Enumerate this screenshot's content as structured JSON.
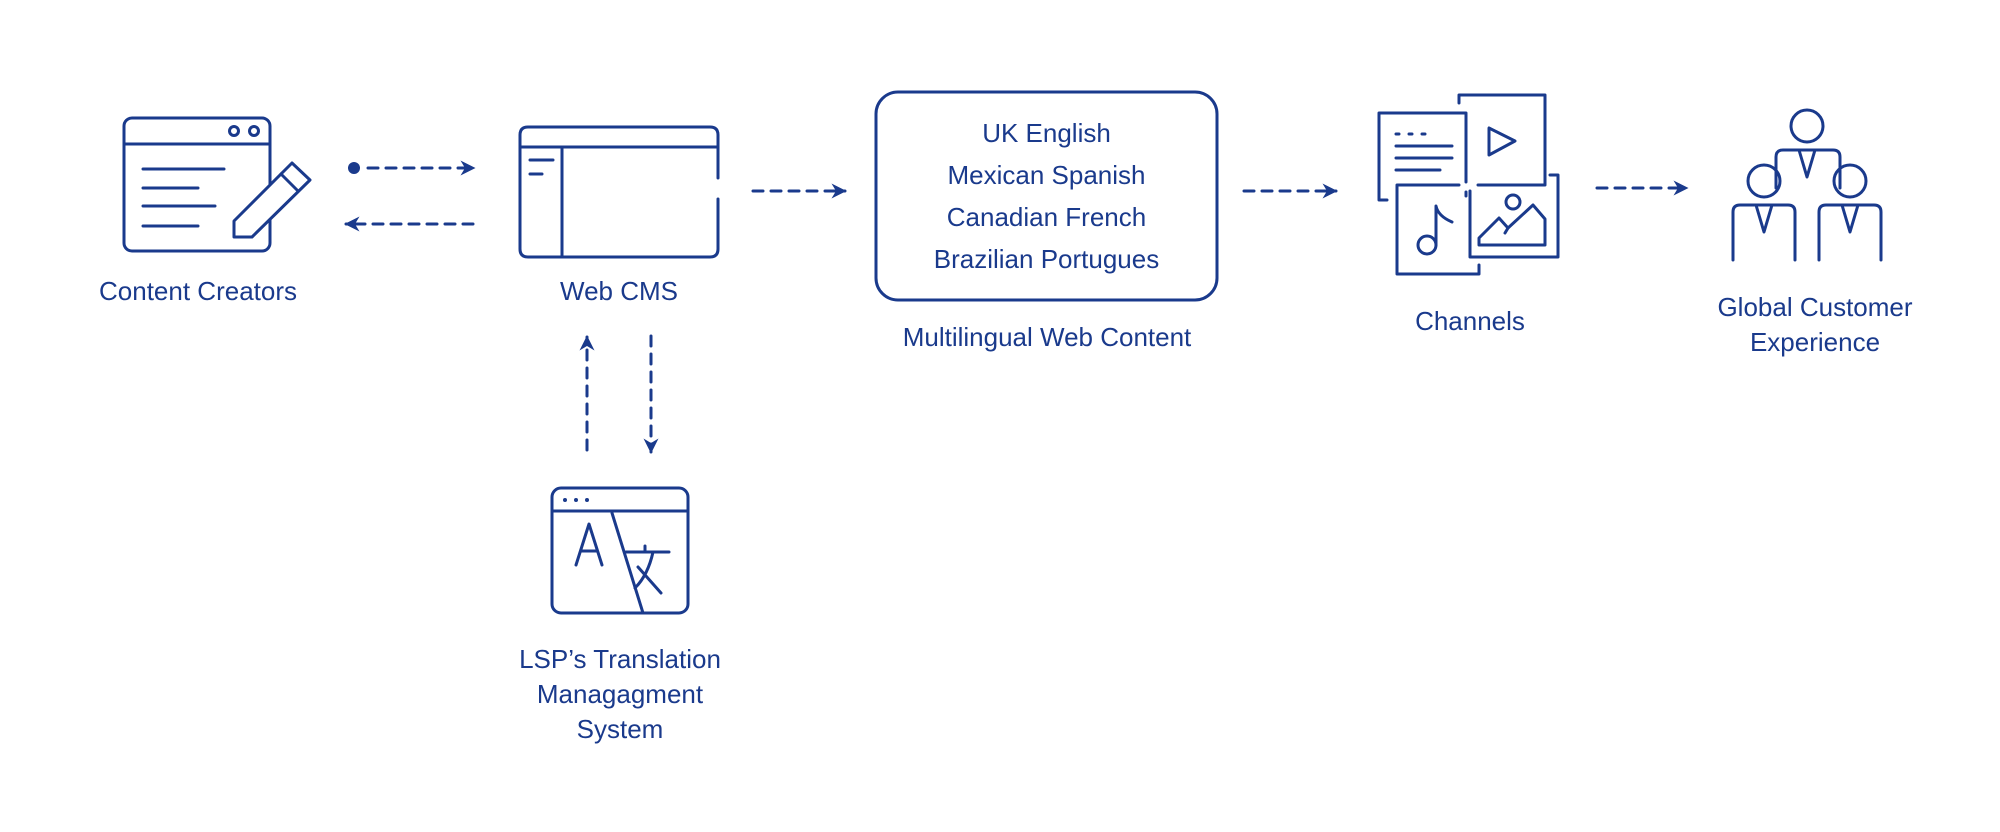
{
  "diagram": {
    "accent_color": "#1a3a8c",
    "nodes": {
      "content_creators": {
        "label": "Content Creators",
        "icon": "document-edit-icon"
      },
      "web_cms": {
        "label": "Web CMS",
        "icon": "cms-window-icon"
      },
      "multilingual": {
        "label": "Multilingual Web Content",
        "languages": [
          "UK English",
          "Mexican Spanish",
          "Canadian French",
          "Brazilian Portugues"
        ]
      },
      "channels": {
        "label": "Channels",
        "icon": "media-channels-icon"
      },
      "global_cx": {
        "label_lines": [
          "Global Customer",
          "Experience"
        ],
        "icon": "people-group-icon"
      },
      "lsp": {
        "label_lines": [
          "LSP’s Translation",
          "Managagment",
          "System"
        ],
        "icon": "translate-window-icon"
      }
    },
    "edges": [
      {
        "from": "content_creators",
        "to": "web_cms",
        "style": "dashed",
        "start": "dot"
      },
      {
        "from": "web_cms",
        "to": "content_creators",
        "style": "dashed"
      },
      {
        "from": "web_cms",
        "to": "multilingual",
        "style": "dashed"
      },
      {
        "from": "multilingual",
        "to": "channels",
        "style": "dashed"
      },
      {
        "from": "channels",
        "to": "global_cx",
        "style": "dashed"
      },
      {
        "from": "lsp",
        "to": "web_cms",
        "style": "dashed"
      },
      {
        "from": "web_cms",
        "to": "lsp",
        "style": "dashed"
      }
    ]
  }
}
